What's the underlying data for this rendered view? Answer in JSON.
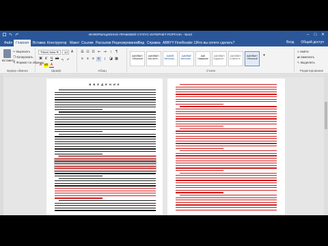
{
  "window": {
    "title": "ИНФОРМАЦИОННО-ПРАВОВОЙ СТАТУС ИНТЕРНЕТ-ПОРТАЛА - Word",
    "controls": [
      "–",
      "□",
      "✕"
    ]
  },
  "tabs": [
    {
      "label": "Файл",
      "active": false
    },
    {
      "label": "Главная",
      "active": true
    },
    {
      "label": "Вставка",
      "active": false
    },
    {
      "label": "Конструктор",
      "active": false
    },
    {
      "label": "Макет",
      "active": false
    },
    {
      "label": "Ссылки",
      "active": false
    },
    {
      "label": "Рассылки",
      "active": false
    },
    {
      "label": "Рецензирование",
      "active": false
    },
    {
      "label": "Вид",
      "active": false
    },
    {
      "label": "Справка",
      "active": false
    },
    {
      "label": "ABBYY FineReader 12",
      "active": false
    },
    {
      "label": "Что вы хотите сделать?",
      "active": false
    }
  ],
  "account": {
    "sign_in": "Вход",
    "share": "Общий доступ"
  },
  "ribbon": {
    "clipboard": {
      "label": "Буфер обмена",
      "paste": "Вставить",
      "cut": "Вырезать",
      "copy": "Копировать",
      "format_painter": "Формат по образцу"
    },
    "font": {
      "label": "Шрифт",
      "family": "Times New R",
      "size": "14"
    },
    "paragraph": {
      "label": "Абзац"
    },
    "styles": {
      "label": "Стили",
      "items": [
        {
          "preview": "АаБбВвГг",
          "name": "Обычный",
          "selected": false
        },
        {
          "preview": "АаБбВвГг",
          "name": "Без инте...",
          "selected": false
        },
        {
          "preview": "АаБбВ",
          "name": "Заголово...",
          "selected": false
        },
        {
          "preview": "АаБбВвГ",
          "name": "Заголово...",
          "selected": false
        },
        {
          "preview": "АаБ",
          "name": "Название",
          "selected": false
        },
        {
          "preview": "АаБбВвГг",
          "name": "Подзагол...",
          "selected": false
        },
        {
          "preview": "АаБбВвГг",
          "name": "Слабое в...",
          "selected": false
        },
        {
          "preview": "АаБбВвГг",
          "name": "Обычный",
          "selected": true
        }
      ]
    },
    "editing": {
      "label": "Редактирование",
      "find": "Найти",
      "replace": "Заменить",
      "select": "Выделить"
    }
  },
  "document": {
    "left_page_heading": "В В Е Д Е Н И Е"
  },
  "colors": {
    "accent": "#2b579a",
    "text_black": "#1a1a1a",
    "text_red": "#d01818",
    "highlight_gray": "#bdbdbd"
  }
}
